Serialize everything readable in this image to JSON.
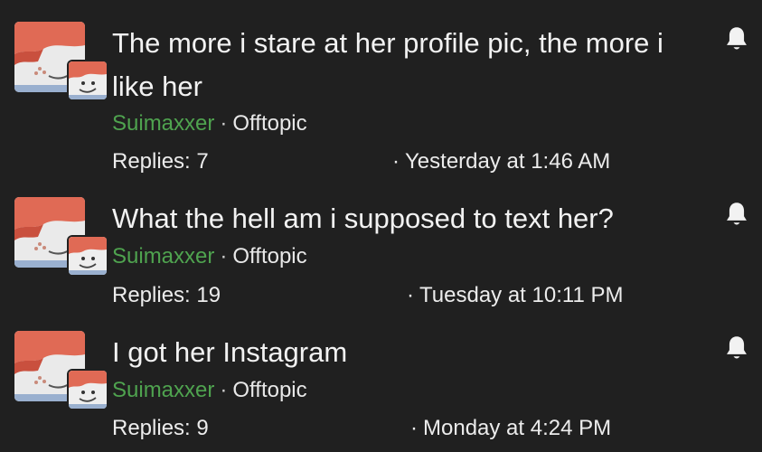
{
  "threads": [
    {
      "title": "The more i stare at her profile pic, the more i like her",
      "author": "Suimaxxer",
      "separator": "·",
      "forum": "Offtopic",
      "replies": "Replies: 7",
      "last_post": "Yesterday at 1:46 AM",
      "bullet": "·",
      "icon": "bell-icon"
    },
    {
      "title": "What the hell am i supposed to text her?",
      "author": "Suimaxxer",
      "separator": "·",
      "forum": "Offtopic",
      "replies": "Replies: 19",
      "last_post": "Tuesday at 10:11 PM",
      "bullet": "·",
      "icon": "bell-icon"
    },
    {
      "title": "I got her Instagram",
      "author": "Suimaxxer",
      "separator": "·",
      "forum": "Offtopic",
      "replies": "Replies: 9",
      "last_post": "Monday at 4:24 PM",
      "bullet": "·",
      "icon": "bell-icon"
    }
  ],
  "colors": {
    "background": "#202020",
    "author": "#4fa34f",
    "text": "#ececec"
  }
}
